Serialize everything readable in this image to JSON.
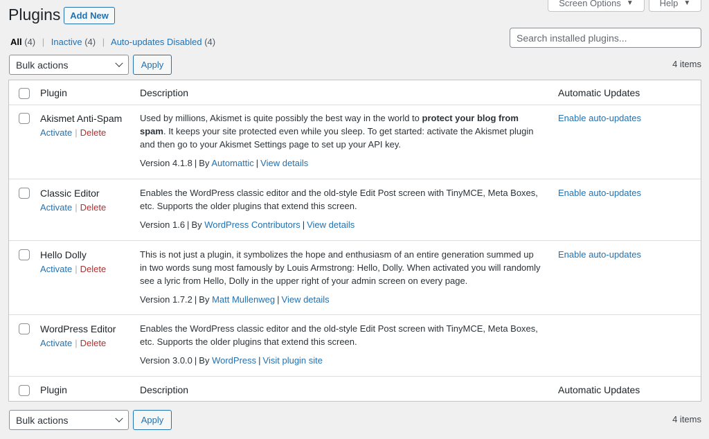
{
  "screen_options": {
    "label": "Screen Options"
  },
  "help": {
    "label": "Help"
  },
  "page_title": "Plugins",
  "add_new": "Add New",
  "filters": {
    "all": "All",
    "all_count": "(4)",
    "inactive": "Inactive",
    "inactive_count": "(4)",
    "auto_disabled": "Auto-updates Disabled",
    "auto_disabled_count": "(4)",
    "separator": "|"
  },
  "search": {
    "placeholder": "Search installed plugins..."
  },
  "bulk": {
    "label": "Bulk actions",
    "apply": "Apply",
    "items": "4 items"
  },
  "table": {
    "headers": {
      "plugin": "Plugin",
      "description": "Description",
      "auto": "Automatic Updates"
    },
    "actions": {
      "activate": "Activate",
      "delete": "Delete"
    },
    "rows": [
      {
        "name": "Akismet Anti-Spam",
        "desc_a": "Used by millions, Akismet is quite possibly the best way in the world to ",
        "desc_bold_a": "protect your blog from",
        "desc_bold_b": "spam",
        "desc_b": ". It keeps your site protected even while you sleep. To get started: activate the Akismet plugin and then go to your Akismet Settings page to set up your API key.",
        "version": "Version 4.1.8",
        "by": "By",
        "author": "Automattic",
        "link": "View details",
        "auto": "Enable auto-updates"
      },
      {
        "name": "Classic Editor",
        "desc": "Enables the WordPress classic editor and the old-style Edit Post screen with TinyMCE, Meta Boxes, etc. Supports the older plugins that extend this screen.",
        "version": "Version 1.6",
        "by": "By",
        "author": "WordPress Contributors",
        "link": "View details",
        "auto": "Enable auto-updates"
      },
      {
        "name": "Hello Dolly",
        "desc": "This is not just a plugin, it symbolizes the hope and enthusiasm of an entire generation summed up in two words sung most famously by Louis Armstrong: Hello, Dolly. When activated you will randomly see a lyric from Hello, Dolly in the upper right of your admin screen on every page.",
        "version": "Version 1.7.2",
        "by": "By",
        "author": "Matt Mullenweg",
        "link": "View details",
        "auto": "Enable auto-updates"
      },
      {
        "name": "WordPress Editor",
        "desc": "Enables the WordPress classic editor and the old-style Edit Post screen with TinyMCE, Meta Boxes, etc. Supports the older plugins that extend this screen.",
        "version": "Version 3.0.0",
        "by": "By",
        "author": "WordPress",
        "link": "Visit plugin site",
        "auto": ""
      }
    ]
  }
}
